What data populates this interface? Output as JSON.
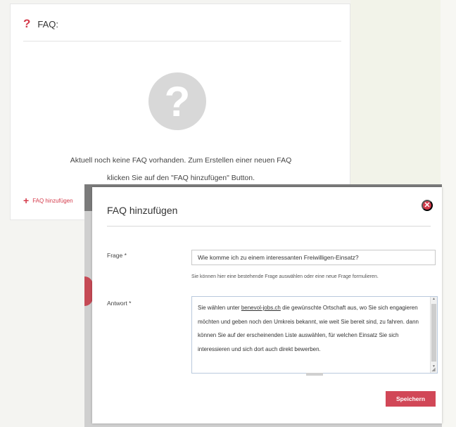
{
  "faq_panel": {
    "header_icon": "question-mark-icon",
    "title": "FAQ:",
    "empty_icon": "question-circle-icon",
    "empty_line1": "Aktuell noch keine FAQ vorhanden. Zum Erstellen einer neuen FAQ",
    "empty_line2": "klicken Sie auf den \"FAQ hinzufügen\" Button.",
    "add_label": "FAQ hinzufügen"
  },
  "modal": {
    "title": "FAQ hinzufügen",
    "frage_label": "Frage *",
    "frage_value": "Wie komme ich zu einem interessanten Freiwilligen-Einsatz?",
    "frage_hint": "Sie können hier eine bestehende Frage auswählen oder eine neue Frage formulieren.",
    "antwort_label": "Antwort *",
    "antwort_pre": "Sie wählen unter ",
    "antwort_link": "benevol-jobs.ch",
    "antwort_post": " die gewünschte Ortschaft aus, wo Sie sich engagieren möchten und geben noch den Umkreis bekannt, wie weit Sie bereit sind, zu fahren. dann können Sie auf der erscheinenden Liste auswählen, für welchen Einsatz Sie sich interessieren und sich dort auch direkt bewerben.",
    "save_label": "Speichern"
  },
  "colors": {
    "accent": "#d43b4b",
    "save_button": "#d14757"
  }
}
